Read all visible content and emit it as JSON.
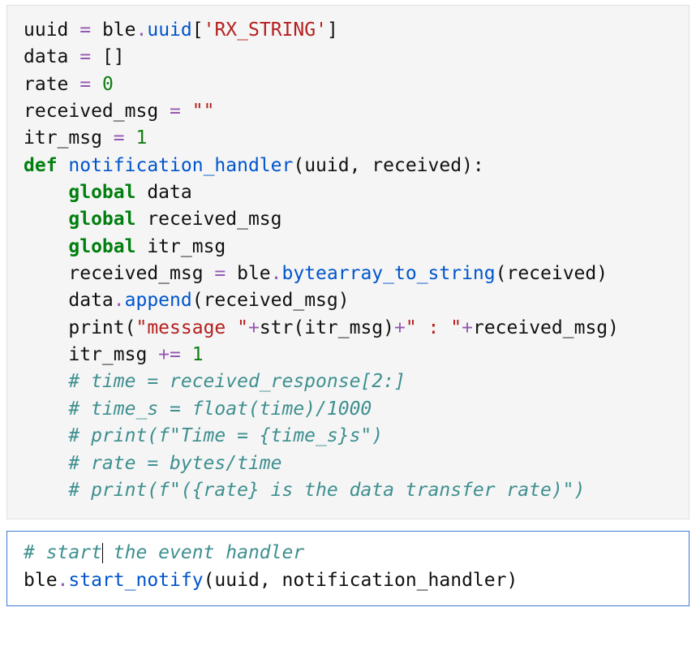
{
  "cell1": {
    "l1a": "uuid ",
    "l1op1": "=",
    "l1b": " ble",
    "l1dot": ".",
    "l1attr": "uuid",
    "l1c": "[",
    "l1str": "'RX_STRING'",
    "l1d": "]",
    "l2a": "data ",
    "l2op": "=",
    "l2b": " []",
    "l3a": "rate ",
    "l3op": "=",
    "l3b": " ",
    "l3num": "0",
    "l4a": "received_msg ",
    "l4op": "=",
    "l4b": " ",
    "l4str": "\"\"",
    "l5a": "itr_msg ",
    "l5op": "=",
    "l5b": " ",
    "l5num": "1",
    "l6kw": "def",
    "l6sp": " ",
    "l6fn": "notification_handler",
    "l6rest": "(uuid, received):",
    "l7ind": "    ",
    "l7kw": "global",
    "l7rest": " data",
    "l8ind": "    ",
    "l8kw": "global",
    "l8rest": " received_msg",
    "l9ind": "    ",
    "l9kw": "global",
    "l9rest": " itr_msg",
    "l10ind": "    ",
    "l10a": "received_msg ",
    "l10op": "=",
    "l10b": " ble",
    "l10dot": ".",
    "l10attr": "bytearray_to_string",
    "l10c": "(received)",
    "l11ind": "    ",
    "l11a": "data",
    "l11dot": ".",
    "l11attr": "append",
    "l11b": "(received_msg)",
    "l12ind": "    ",
    "l12a": "print(",
    "l12s1": "\"message \"",
    "l12op1": "+",
    "l12b": "str(itr_msg)",
    "l12op2": "+",
    "l12s2": "\" : \"",
    "l12op3": "+",
    "l12c": "received_msg)",
    "l13ind": "    ",
    "l13a": "itr_msg ",
    "l13op": "+=",
    "l13b": " ",
    "l13num": "1",
    "l14ind": "    ",
    "l14com": "# time = received_response[2:]",
    "l15ind": "    ",
    "l15com": "# time_s = float(time)/1000",
    "l16ind": "    ",
    "l16com": "# print(f\"Time = {time_s}s\")",
    "l17ind": "    ",
    "l17com": "# rate = bytes/time",
    "l18ind": "    ",
    "l18com": "# print(f\"({rate} is the data transfer rate)\")"
  },
  "cell2": {
    "c1a": "# start",
    "c1b": " the event handler",
    "l2a": "ble",
    "l2dot": ".",
    "l2attr": "start_notify",
    "l2b": "(uuid, notification_handler)"
  }
}
